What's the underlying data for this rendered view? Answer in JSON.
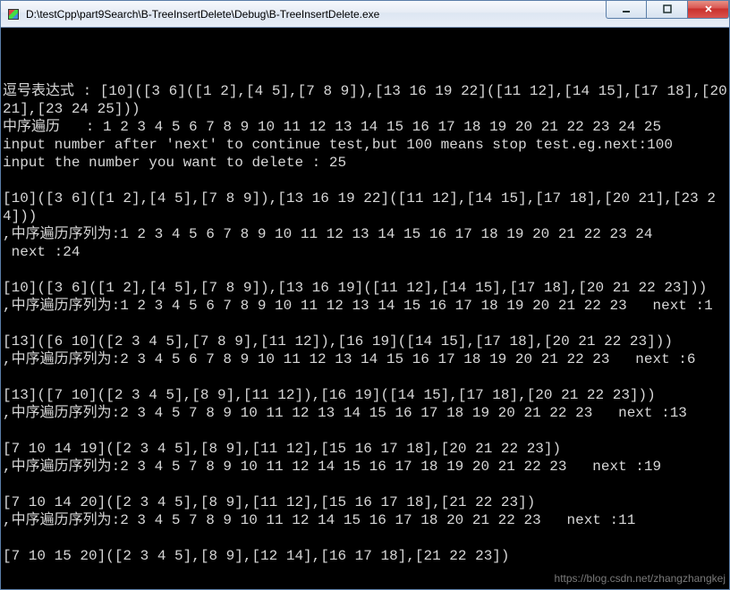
{
  "window": {
    "title": "D:\\testCpp\\part9Search\\B-TreeInsertDelete\\Debug\\B-TreeInsertDelete.exe",
    "icon_name": "console-app-icon"
  },
  "win_buttons": {
    "minimize_label": "minimize",
    "maximize_label": "maximize",
    "close_label": "close"
  },
  "console_lines": [
    "逗号表达式 : [10]([3 6]([1 2],[4 5],[7 8 9]),[13 16 19 22]([11 12],[14 15],[17 18],[20 21],[23 24 25]))",
    "中序遍历   : 1 2 3 4 5 6 7 8 9 10 11 12 13 14 15 16 17 18 19 20 21 22 23 24 25",
    "input number after 'next' to continue test,but 100 means stop test.eg.next:100",
    "input the number you want to delete : 25",
    "",
    "[10]([3 6]([1 2],[4 5],[7 8 9]),[13 16 19 22]([11 12],[14 15],[17 18],[20 21],[23 24]))",
    ",中序遍历序列为:1 2 3 4 5 6 7 8 9 10 11 12 13 14 15 16 17 18 19 20 21 22 23 24",
    " next :24",
    "",
    "[10]([3 6]([1 2],[4 5],[7 8 9]),[13 16 19]([11 12],[14 15],[17 18],[20 21 22 23]))",
    ",中序遍历序列为:1 2 3 4 5 6 7 8 9 10 11 12 13 14 15 16 17 18 19 20 21 22 23   next :1",
    "",
    "[13]([6 10]([2 3 4 5],[7 8 9],[11 12]),[16 19]([14 15],[17 18],[20 21 22 23]))",
    ",中序遍历序列为:2 3 4 5 6 7 8 9 10 11 12 13 14 15 16 17 18 19 20 21 22 23   next :6",
    "",
    "[13]([7 10]([2 3 4 5],[8 9],[11 12]),[16 19]([14 15],[17 18],[20 21 22 23]))",
    ",中序遍历序列为:2 3 4 5 7 8 9 10 11 12 13 14 15 16 17 18 19 20 21 22 23   next :13",
    "",
    "[7 10 14 19]([2 3 4 5],[8 9],[11 12],[15 16 17 18],[20 21 22 23])",
    ",中序遍历序列为:2 3 4 5 7 8 9 10 11 12 14 15 16 17 18 19 20 21 22 23   next :19",
    "",
    "[7 10 14 20]([2 3 4 5],[8 9],[11 12],[15 16 17 18],[21 22 23])",
    ",中序遍历序列为:2 3 4 5 7 8 9 10 11 12 14 15 16 17 18 20 21 22 23   next :11",
    "",
    "[7 10 15 20]([2 3 4 5],[8 9],[12 14],[16 17 18],[21 22 23])"
  ],
  "watermark": "https://blog.csdn.net/zhangzhangkej"
}
